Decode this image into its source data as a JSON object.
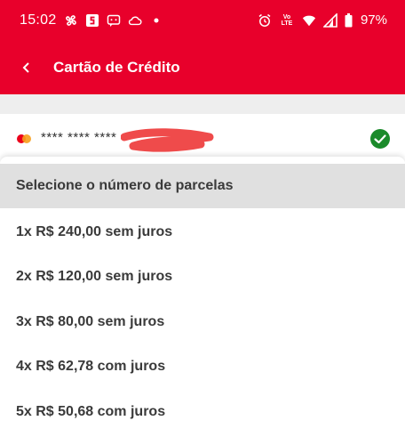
{
  "status_bar": {
    "time": "15:02",
    "battery": "97%",
    "icons_left": [
      "pinwheel-icon",
      "s-app-icon",
      "message-icon",
      "cloud-icon",
      "dot-icon"
    ],
    "icons_right": [
      "alarm-icon",
      "volte-icon",
      "wifi-icon",
      "signal-icon",
      "battery-icon"
    ],
    "volte_line1": "Vo",
    "volte_line2": "LTE"
  },
  "app_bar": {
    "title": "Cartão de Crédito",
    "color": "#e8002b"
  },
  "card": {
    "number": "**** **** ****",
    "brand_icon": "mastercard-icon",
    "selected": true,
    "check_color": "#1a8a2a"
  },
  "installments": {
    "header": "Selecione o número de parcelas",
    "options": [
      {
        "label": "1x R$ 240,00 sem juros"
      },
      {
        "label": "2x R$ 120,00 sem juros"
      },
      {
        "label": "3x R$ 80,00 sem juros"
      },
      {
        "label": "4x R$ 62,78 com juros"
      },
      {
        "label": "5x R$ 50,68 com juros"
      }
    ]
  }
}
